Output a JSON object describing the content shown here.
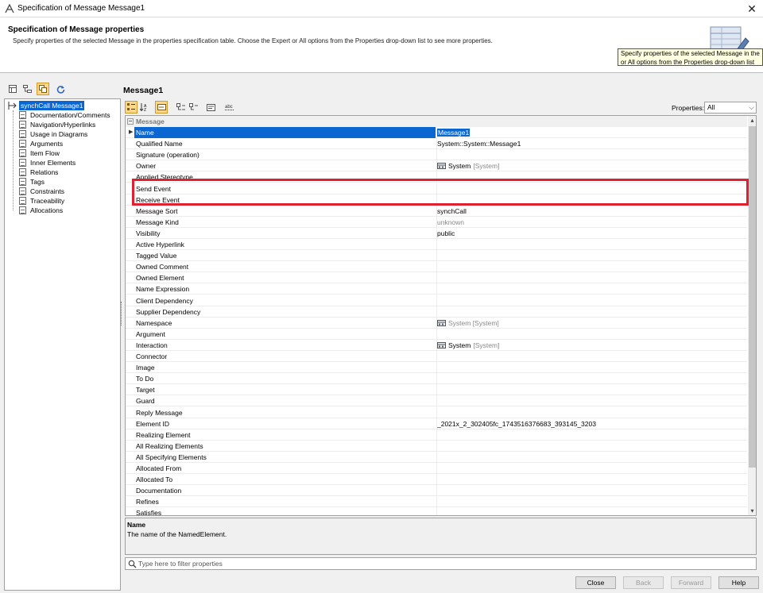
{
  "window": {
    "title": "Specification of Message Message1",
    "close_glyph": "✕"
  },
  "header": {
    "title": "Specification of Message properties",
    "description": "Specify properties of the selected Message in the properties specification table. Choose the Expert or All options from the Properties drop-down list to see more properties.",
    "tooltip_line1": "Specify properties of the selected Message in the",
    "tooltip_line2": "or All options from the Properties drop-down list"
  },
  "tree": {
    "root": "synchCall Message1",
    "items": [
      "Documentation/Comments",
      "Navigation/Hyperlinks",
      "Usage in Diagrams",
      "Arguments",
      "Item Flow",
      "Inner Elements",
      "Relations",
      "Tags",
      "Constraints",
      "Traceability",
      "Allocations"
    ]
  },
  "main": {
    "title": "Message1",
    "properties_label": "Properties:",
    "properties_value": "All",
    "group": "Message",
    "rows": [
      {
        "name": "Name",
        "value": "Message1",
        "selected": true
      },
      {
        "name": "Qualified Name",
        "value": "System::System::Message1"
      },
      {
        "name": "Signature (operation)",
        "value": ""
      },
      {
        "name": "Owner",
        "value": "System",
        "value_extra": "[System]",
        "icon": true
      },
      {
        "name": "Applied Stereotype",
        "value": ""
      },
      {
        "name": "Send Event",
        "value": ""
      },
      {
        "name": "Receive Event",
        "value": ""
      },
      {
        "name": "Message Sort",
        "value": "synchCall"
      },
      {
        "name": "Message Kind",
        "value": "unknown",
        "grey": true
      },
      {
        "name": "Visibility",
        "value": "public"
      },
      {
        "name": "Active Hyperlink",
        "value": ""
      },
      {
        "name": "Tagged Value",
        "value": ""
      },
      {
        "name": "Owned Comment",
        "value": ""
      },
      {
        "name": "Owned Element",
        "value": ""
      },
      {
        "name": "Name Expression",
        "value": ""
      },
      {
        "name": "Client Dependency",
        "value": ""
      },
      {
        "name": "Supplier Dependency",
        "value": ""
      },
      {
        "name": "Namespace",
        "value": "System [System]",
        "grey": true,
        "icon": true
      },
      {
        "name": "Argument",
        "value": ""
      },
      {
        "name": "Interaction",
        "value": "System",
        "value_extra": "[System]",
        "icon": true
      },
      {
        "name": "Connector",
        "value": ""
      },
      {
        "name": "Image",
        "value": ""
      },
      {
        "name": "To Do",
        "value": ""
      },
      {
        "name": "Target",
        "value": ""
      },
      {
        "name": "Guard",
        "value": ""
      },
      {
        "name": "Reply Message",
        "value": ""
      },
      {
        "name": "Element ID",
        "value": "_2021x_2_302405fc_1743516376683_393145_3203"
      },
      {
        "name": "Realizing Element",
        "value": ""
      },
      {
        "name": "All Realizing Elements",
        "value": ""
      },
      {
        "name": "All Specifying Elements",
        "value": ""
      },
      {
        "name": "Allocated From",
        "value": ""
      },
      {
        "name": "Allocated To",
        "value": ""
      },
      {
        "name": "Documentation",
        "value": ""
      },
      {
        "name": "Refines",
        "value": ""
      },
      {
        "name": "Satisfies",
        "value": ""
      }
    ],
    "ellipsis": "..."
  },
  "description_panel": {
    "title": "Name",
    "text": "The name of the NamedElement."
  },
  "filter": {
    "placeholder": "Type here to filter properties"
  },
  "buttons": {
    "close": "Close",
    "back": "Back",
    "forward": "Forward",
    "help": "Help"
  },
  "colors": {
    "selection": "#0a66d1",
    "highlight": "#e0202e",
    "active_tool": "#fbd789"
  }
}
